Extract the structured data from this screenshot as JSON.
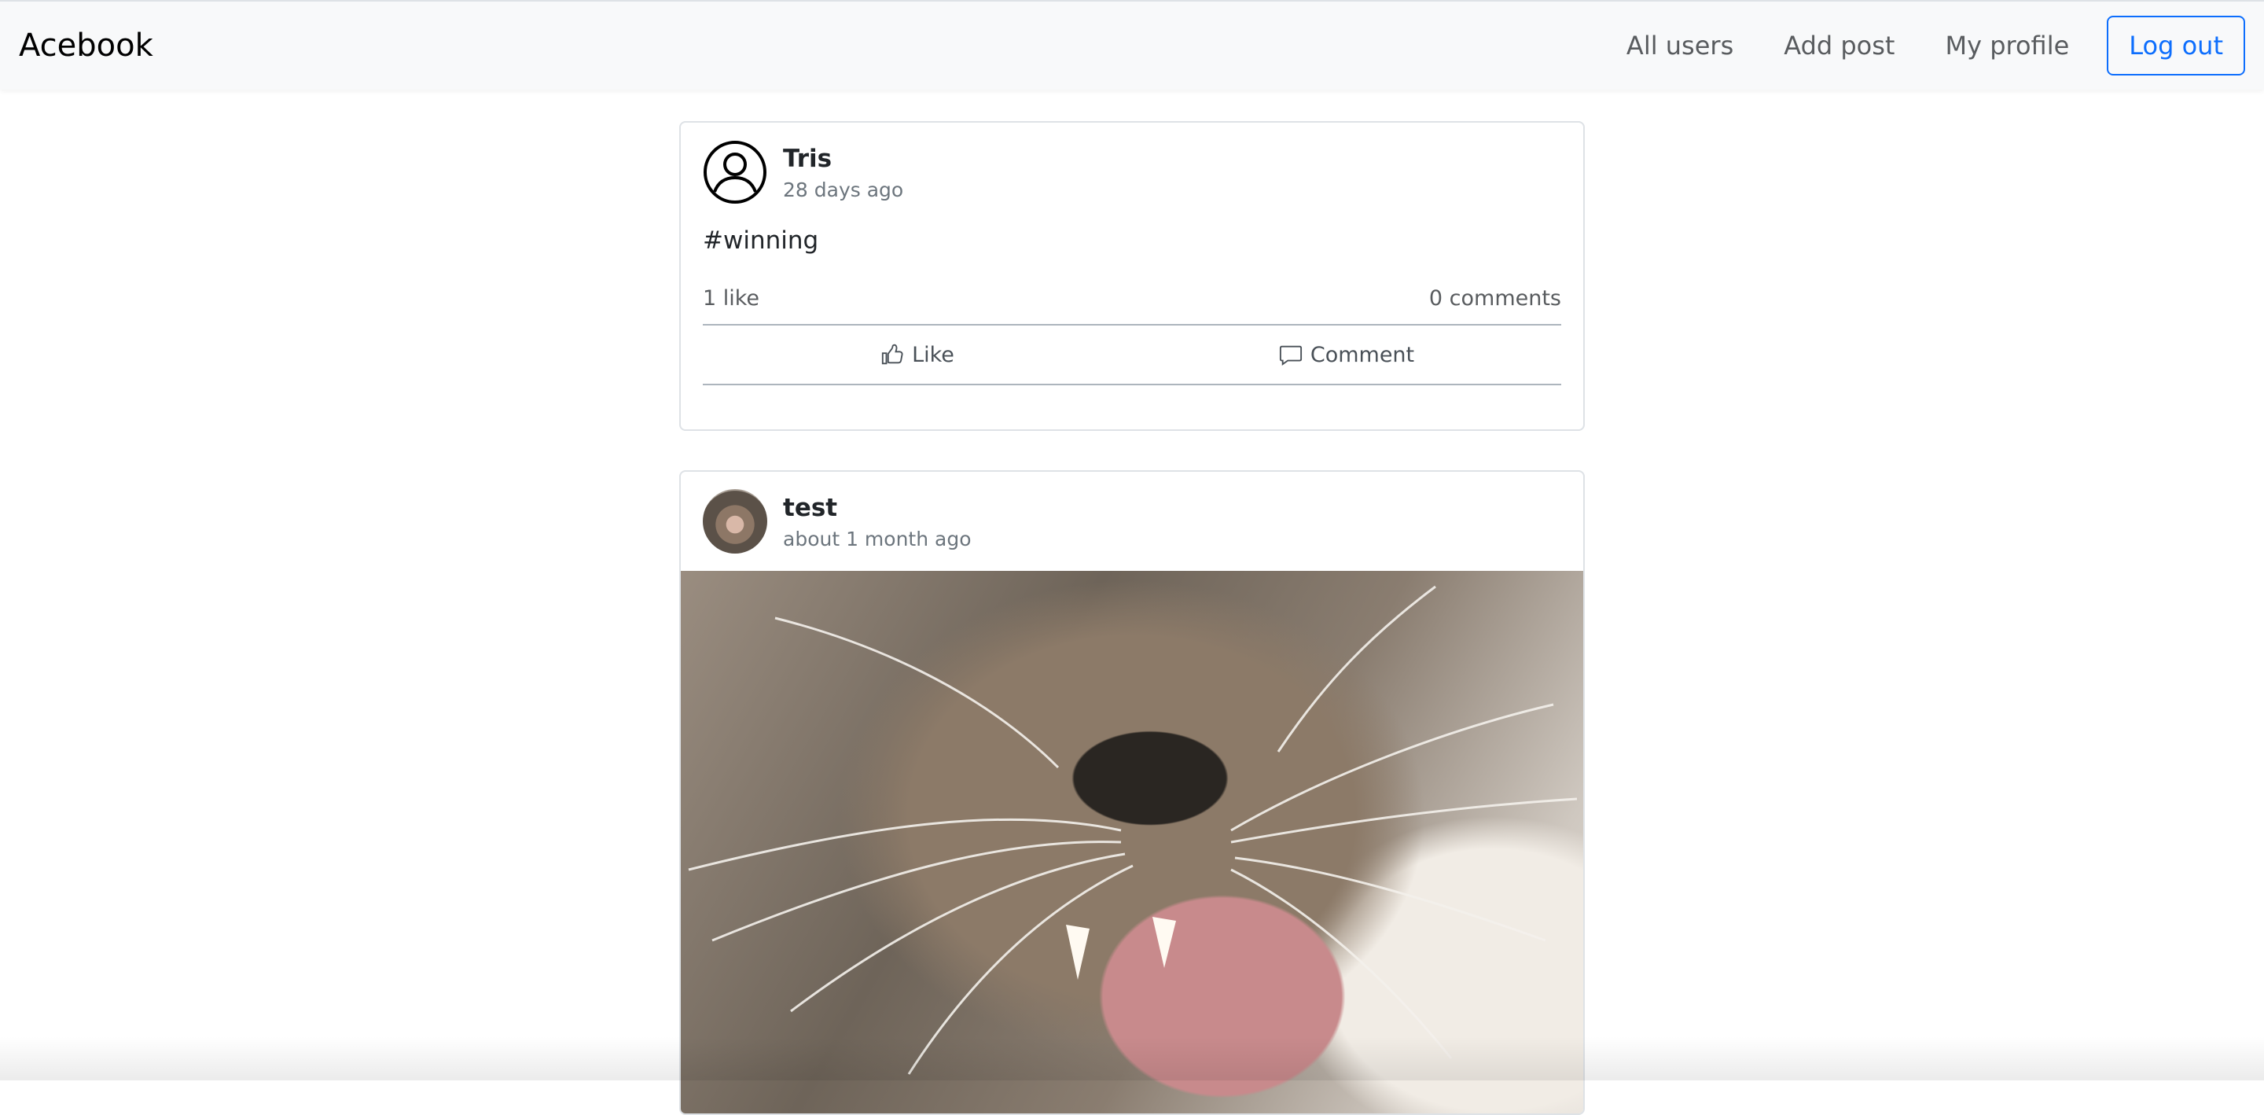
{
  "navbar": {
    "brand": "Acebook",
    "links": [
      "All users",
      "Add post",
      "My profile"
    ],
    "logout_label": "Log out"
  },
  "posts": [
    {
      "author": "Tris",
      "timestamp": "28 days ago",
      "body": "#winning",
      "likes": "1 like",
      "comments": "0 comments",
      "like_label": "Like",
      "comment_label": "Comment",
      "avatar": "user-outline-icon"
    },
    {
      "author": "test",
      "timestamp": "about 1 month ago",
      "avatar": "cat-photo",
      "image": "yawning-cat-photo"
    }
  ],
  "colors": {
    "primary": "#0d6efd",
    "navbar_bg": "#f8f9fa",
    "muted_text": "#6c757d"
  }
}
